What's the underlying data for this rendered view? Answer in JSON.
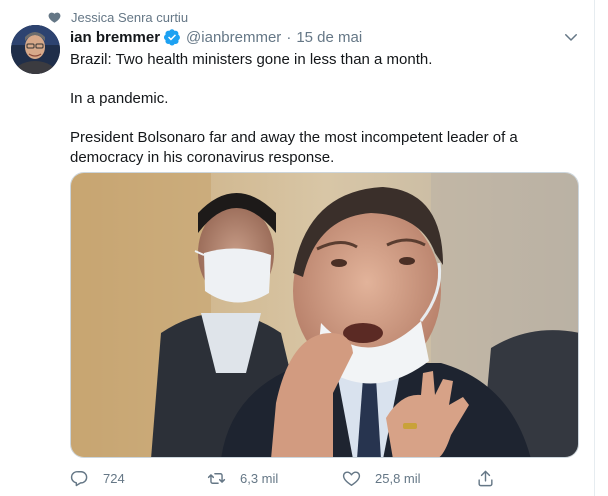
{
  "social_context": {
    "icon": "heart-icon",
    "text": "Jessica Senra curtiu"
  },
  "author": {
    "display_name": "ian bremmer",
    "verified_icon": "verified-badge-icon",
    "handle": "@ianbremmer",
    "separator": "·",
    "date": "15 de mai"
  },
  "tweet": {
    "paragraphs": [
      "Brazil: Two health ministers gone in less than a month.",
      "In a pandemic.",
      "President Bolsonaro far and away the most incompetent leader of a democracy in his coronavirus response."
    ]
  },
  "media": {
    "icon": "photo"
  },
  "actions": {
    "reply": {
      "icon": "reply-icon",
      "count": "724"
    },
    "retweet": {
      "icon": "retweet-icon",
      "count": "6,3 mil"
    },
    "like": {
      "icon": "like-icon",
      "count": "25,8 mil"
    },
    "share": {
      "icon": "share-icon"
    }
  },
  "colors": {
    "accent": "#1da1f2",
    "secondary_text": "#657786",
    "primary_text": "#14171a",
    "border": "#e6ecf0"
  }
}
